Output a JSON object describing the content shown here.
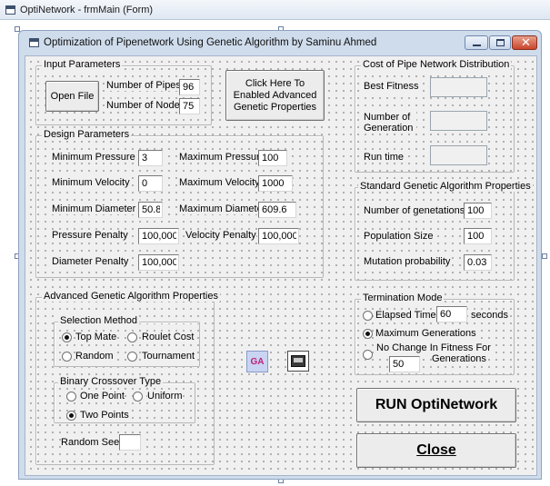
{
  "designer": {
    "title": "OptiNetwork - frmMain (Form)"
  },
  "form": {
    "title": "Optimization of Pipenetwork Using Genetic Algorithm by Saminu Ahmed"
  },
  "input_parameters": {
    "title": "Input Parameters",
    "open_file_label": "Open File",
    "num_pipes_label": "Number of Pipes",
    "num_pipes_value": "96",
    "num_nodes_label": "Number of Nodes",
    "num_nodes_value": "75"
  },
  "advanced_button": {
    "label": "Click Here To Enabled Advanced Genetic Properties"
  },
  "cost_distribution": {
    "title": "Cost of Pipe Network Distribution",
    "best_fitness_label": "Best Fitness",
    "best_fitness_value": "",
    "num_generation_label": "Number of Generation",
    "num_generation_value": "",
    "run_time_label": "Run time",
    "run_time_value": ""
  },
  "design_parameters": {
    "title": "Design Parameters",
    "min_pressure_label": "Minimum Pressure",
    "min_pressure_value": "3",
    "max_pressure_label": "Maximum Pressure",
    "max_pressure_value": "100",
    "min_velocity_label": "Minimum Velocity",
    "min_velocity_value": "0",
    "max_velocity_label": "Maximum Velocity",
    "max_velocity_value": "1000",
    "min_diameter_label": "Minimum Diameter",
    "min_diameter_value": "50.8",
    "max_diameter_label": "Maximum Diameter",
    "max_diameter_value": "609.6",
    "pressure_penalty_label": "Pressure Penalty",
    "pressure_penalty_value": "100,000",
    "velocity_penalty_label": "Velocity Penalty",
    "velocity_penalty_value": "100,000",
    "diameter_penalty_label": "Diameter Penalty",
    "diameter_penalty_value": "100,000"
  },
  "standard_ga": {
    "title": "Standard Genetic Algorithm Properties",
    "num_generations_label": "Number of genetations",
    "num_generations_value": "100",
    "population_label": "Population Size",
    "population_value": "100",
    "mutation_label": "Mutation probability",
    "mutation_value": "0.03"
  },
  "advanced_ga": {
    "title": "Advanced Genetic Algorithm Properties",
    "selection": {
      "title": "Selection Method",
      "top_mate": "Top Mate",
      "roulet_cost": "Roulet Cost",
      "random": "Random",
      "tournament": "Tournament",
      "selected": "top_mate"
    },
    "crossover": {
      "title": "Binary Crossover Type",
      "one_point": "One Point",
      "uniform": "Uniform",
      "two_points": "Two Points",
      "selected": "two_points"
    },
    "random_seed_label": "Random Seed",
    "random_seed_value": ""
  },
  "icons": {
    "ga_label": "GA",
    "timer_icon": "timer-icon"
  },
  "termination": {
    "title": "Termination Mode",
    "elapsed_time_label": "Elapsed Time",
    "elapsed_time_value": "60",
    "seconds_label": "seconds",
    "max_generations_label": "Maximum Generations",
    "no_change_label": "No Change In Fitness For",
    "no_change_value": "50",
    "generations_label": "Generations",
    "selected": "max_generations"
  },
  "actions": {
    "run_label": "RUN OptiNetwork",
    "close_label": "Close"
  },
  "colors": {
    "form_frame": "#cfdcec",
    "client_bg": "#f0f0f0",
    "close_button": "#c9452b",
    "ga_icon_bg": "#c8d4f2",
    "ga_icon_text": "#c0207a"
  }
}
